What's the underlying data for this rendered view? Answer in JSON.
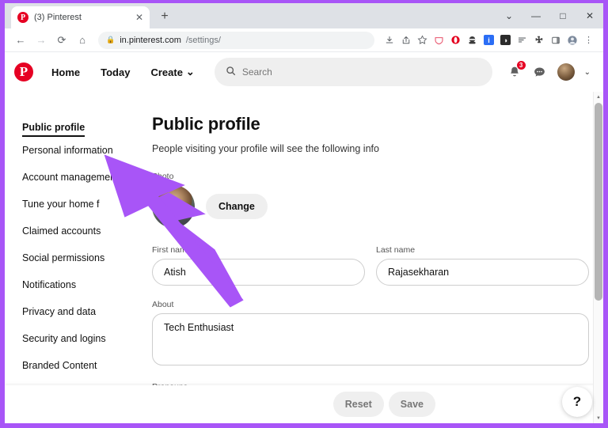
{
  "browser": {
    "tab": {
      "title": "(3) Pinterest",
      "favicon": "pinterest-icon",
      "close_label": "✕"
    },
    "new_tab_label": "+",
    "window_controls": [
      {
        "name": "tab-search-chevron",
        "glyph": "⌄"
      },
      {
        "name": "minimize",
        "glyph": "—"
      },
      {
        "name": "maximize",
        "glyph": "□"
      },
      {
        "name": "close",
        "glyph": "✕"
      }
    ],
    "nav": {
      "back": "←",
      "forward": "→",
      "reload": "⟳",
      "home": "⌂"
    },
    "omnibox": {
      "lock": "🔒",
      "host": "in.pinterest.com",
      "path": "/settings/"
    },
    "toolbar_icons": [
      {
        "name": "install-app-icon",
        "glyph": "⬇",
        "color": "#5f6368",
        "bg": ""
      },
      {
        "name": "share-icon",
        "glyph": "↱",
        "color": "#5f6368",
        "bg": ""
      },
      {
        "name": "bookmark-star-icon",
        "glyph": "☆",
        "color": "#5f6368",
        "bg": ""
      },
      {
        "name": "shield-extension-icon",
        "glyph": "♡",
        "color": "#e8526b",
        "bg": ""
      },
      {
        "name": "opera-extension-icon",
        "glyph": "O",
        "color": "#e4001e",
        "bg": ""
      },
      {
        "name": "ninja-extension-icon",
        "glyph": "♟",
        "color": "#444444",
        "bg": ""
      },
      {
        "name": "info-extension-icon",
        "glyph": "i",
        "color": "#ffffff",
        "bg": "#2b6ef5"
      },
      {
        "name": "dark-mode-extension-icon",
        "glyph": "◢",
        "color": "#ffffff",
        "bg": "#2b2b2b"
      },
      {
        "name": "list-extension-icon",
        "glyph": "≡",
        "color": "#5f6368",
        "bg": ""
      },
      {
        "name": "extensions-puzzle-icon",
        "glyph": "✦",
        "color": "#4a4a4a",
        "bg": ""
      },
      {
        "name": "side-panel-icon",
        "glyph": "❑",
        "color": "#5f6368",
        "bg": ""
      },
      {
        "name": "profile-avatar-icon",
        "glyph": "●",
        "color": "#6b7a8f",
        "bg": ""
      },
      {
        "name": "chrome-menu-icon",
        "glyph": "⋮",
        "color": "#5f6368",
        "bg": ""
      }
    ]
  },
  "pinterest_header": {
    "logo": "P",
    "links": [
      {
        "label": "Home",
        "name": "nav-home"
      },
      {
        "label": "Today",
        "name": "nav-today"
      },
      {
        "label": "Create",
        "name": "nav-create",
        "caret": "⌄"
      }
    ],
    "search": {
      "placeholder": "Search",
      "icon": "search-icon"
    },
    "notifications": {
      "icon": "bell-icon",
      "count": "3"
    },
    "messages": {
      "icon": "chat-bubble-icon"
    },
    "account_chevron": "⌄"
  },
  "sidebar": {
    "items": [
      {
        "label": "Public profile",
        "active": true
      },
      {
        "label": "Personal information",
        "active": false
      },
      {
        "label": "Account management",
        "active": false
      },
      {
        "label": "Tune your home f",
        "active": false
      },
      {
        "label": "Claimed accounts",
        "active": false
      },
      {
        "label": "Social permissions",
        "active": false
      },
      {
        "label": "Notifications",
        "active": false
      },
      {
        "label": "Privacy and data",
        "active": false
      },
      {
        "label": "Security and logins",
        "active": false
      },
      {
        "label": "Branded Content",
        "active": false
      }
    ]
  },
  "main": {
    "title": "Public profile",
    "subtitle": "People visiting your profile will see the following info",
    "photo": {
      "label": "Photo",
      "change_button": "Change"
    },
    "first_name": {
      "label": "First name",
      "value": "Atish"
    },
    "last_name": {
      "label": "Last name",
      "value": "Rajasekharan"
    },
    "about": {
      "label": "About",
      "value": "Tech Enthusiast"
    },
    "pronouns": {
      "label": "Pronouns"
    }
  },
  "bottom_bar": {
    "reset": "Reset",
    "save": "Save",
    "help": "?"
  },
  "colors": {
    "pinterest_red": "#e60023",
    "annotation_purple": "#a855f7",
    "frame_purple": "#a855f7",
    "input_border": "#cdcdcd",
    "chip_gray": "#efefef"
  }
}
